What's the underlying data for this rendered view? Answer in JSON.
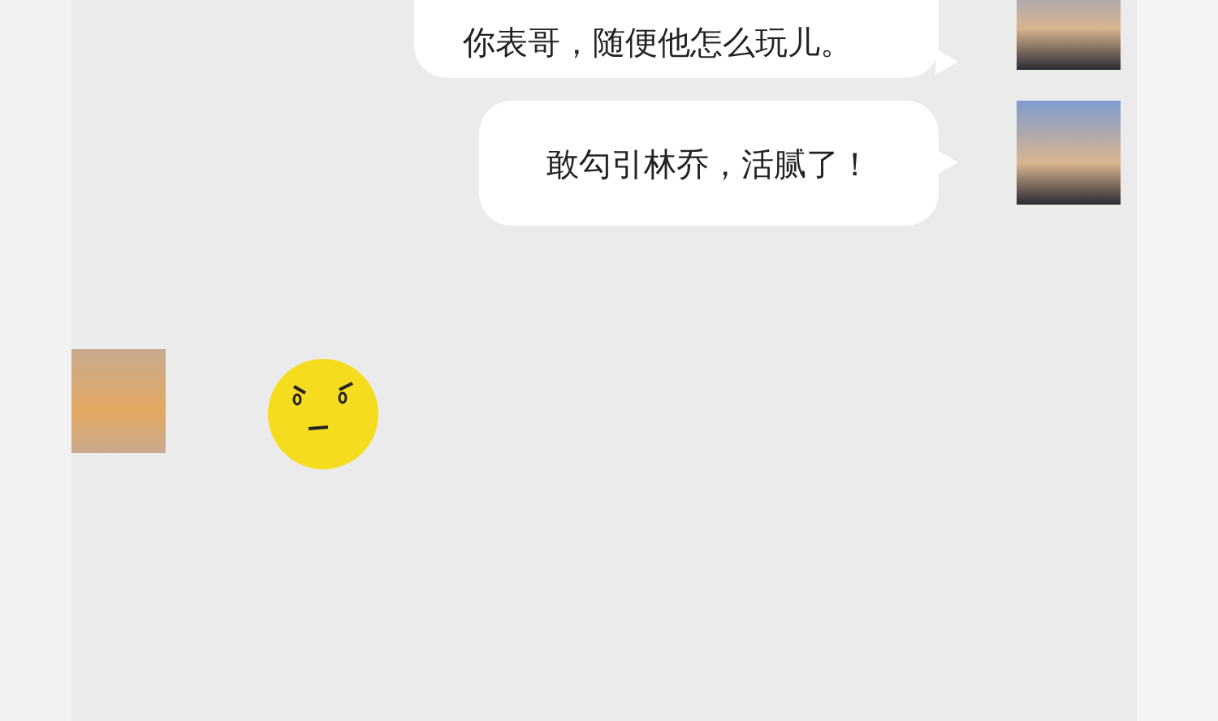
{
  "messages": [
    {
      "kind": "text",
      "outgoing": true,
      "text": "你表哥，随便他怎么玩儿。"
    },
    {
      "kind": "text",
      "outgoing": true,
      "text": "敢勾引林乔，活腻了！"
    },
    {
      "kind": "sticker",
      "outgoing": false
    }
  ]
}
